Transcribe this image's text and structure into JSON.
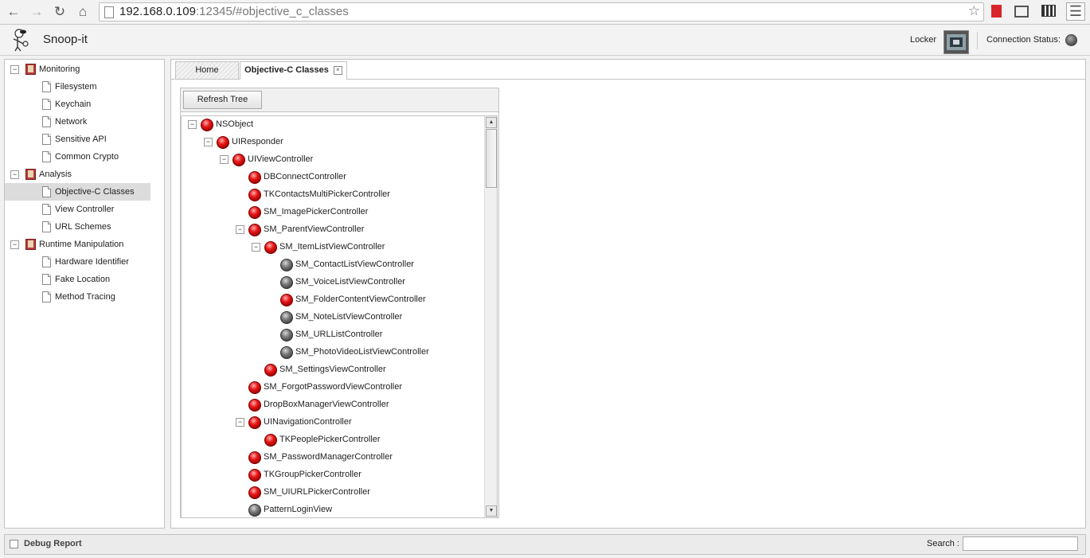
{
  "browser": {
    "url_host": "192.168.0.109",
    "url_rest": ":12345/#objective_c_classes",
    "icons": [
      "back-icon",
      "forward-icon",
      "reload-icon",
      "home-icon",
      "star-icon",
      "bookmark-extension-icon",
      "cast-icon",
      "clapper-extension-icon",
      "menu-icon"
    ]
  },
  "app": {
    "title": "Snoop-it",
    "locker_label": "Locker",
    "connection_label": "Connection Status:",
    "connection_state_color": "#555555"
  },
  "sidebar": {
    "groups": [
      {
        "label": "Monitoring",
        "items": [
          {
            "label": "Filesystem"
          },
          {
            "label": "Keychain"
          },
          {
            "label": "Network"
          },
          {
            "label": "Sensitive API"
          },
          {
            "label": "Common Crypto"
          }
        ]
      },
      {
        "label": "Analysis",
        "items": [
          {
            "label": "Objective-C Classes",
            "selected": true
          },
          {
            "label": "View Controller"
          },
          {
            "label": "URL Schemes"
          }
        ]
      },
      {
        "label": "Runtime Manipulation",
        "items": [
          {
            "label": "Hardware Identifier"
          },
          {
            "label": "Fake Location"
          },
          {
            "label": "Method Tracing"
          }
        ]
      }
    ]
  },
  "tabs": [
    {
      "label": "Home",
      "active": false
    },
    {
      "label": "Objective-C Classes",
      "active": true
    }
  ],
  "tree": {
    "refresh_label": "Refresh Tree",
    "nodes": [
      {
        "label": "NSObject",
        "depth": 0,
        "color": "red",
        "expanded": true
      },
      {
        "label": "UIResponder",
        "depth": 1,
        "color": "red",
        "expanded": true
      },
      {
        "label": "UIViewController",
        "depth": 2,
        "color": "red",
        "expanded": true
      },
      {
        "label": "DBConnectController",
        "depth": 3,
        "color": "red"
      },
      {
        "label": "TKContactsMultiPickerController",
        "depth": 3,
        "color": "red"
      },
      {
        "label": "SM_ImagePickerController",
        "depth": 3,
        "color": "red"
      },
      {
        "label": "SM_ParentViewController",
        "depth": 3,
        "color": "red",
        "expanded": true
      },
      {
        "label": "SM_ItemListViewController",
        "depth": 4,
        "color": "red",
        "expanded": true
      },
      {
        "label": "SM_ContactListViewController",
        "depth": 5,
        "color": "gray"
      },
      {
        "label": "SM_VoiceListViewController",
        "depth": 5,
        "color": "gray"
      },
      {
        "label": "SM_FolderContentViewController",
        "depth": 5,
        "color": "red"
      },
      {
        "label": "SM_NoteListViewController",
        "depth": 5,
        "color": "gray"
      },
      {
        "label": "SM_URLListController",
        "depth": 5,
        "color": "gray"
      },
      {
        "label": "SM_PhotoVideoListViewController",
        "depth": 5,
        "color": "gray"
      },
      {
        "label": "SM_SettingsViewController",
        "depth": 4,
        "color": "red"
      },
      {
        "label": "SM_ForgotPasswordViewController",
        "depth": 3,
        "color": "red"
      },
      {
        "label": "DropBoxManagerViewController",
        "depth": 3,
        "color": "red"
      },
      {
        "label": "UINavigationController",
        "depth": 3,
        "color": "red",
        "expanded": true
      },
      {
        "label": "TKPeoplePickerController",
        "depth": 4,
        "color": "red"
      },
      {
        "label": "SM_PasswordManagerController",
        "depth": 3,
        "color": "red"
      },
      {
        "label": "TKGroupPickerController",
        "depth": 3,
        "color": "red"
      },
      {
        "label": "SM_UIURLPickerController",
        "depth": 3,
        "color": "red"
      },
      {
        "label": "PatternLoginView",
        "depth": 3,
        "color": "gray"
      }
    ]
  },
  "status": {
    "debug_label": "Debug Report",
    "search_label": "Search :",
    "search_value": ""
  }
}
